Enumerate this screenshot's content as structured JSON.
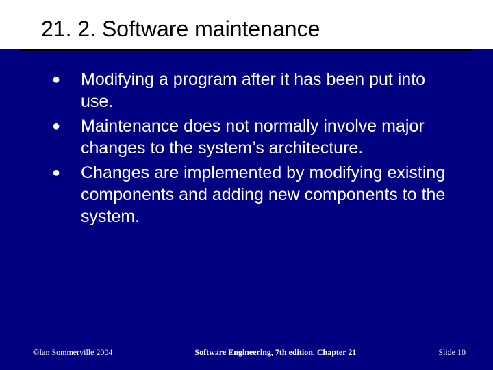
{
  "slide": {
    "title": "21. 2. Software maintenance",
    "bullets": [
      "Modifying a program after it has been put into use.",
      "Maintenance does not normally involve major changes to the system’s architecture.",
      "Changes are implemented by modifying existing components and adding new components to the system."
    ],
    "footer": {
      "left": "©Ian Sommerville 2004",
      "center": "Software Engineering, 7th edition. Chapter 21",
      "right": "Slide 10"
    }
  }
}
